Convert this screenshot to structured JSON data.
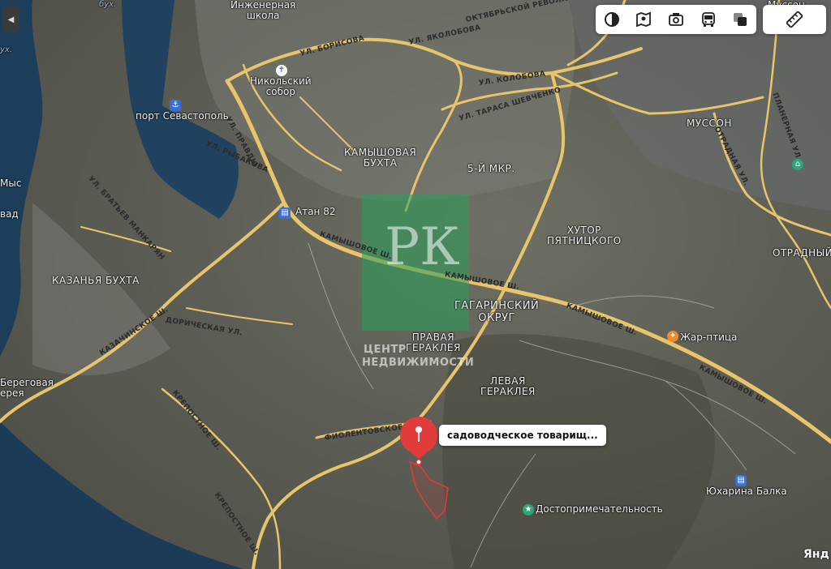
{
  "map": {
    "place_labels": {
      "engineering_school": "Инженерная\nшкола",
      "nikolsky": "Никольский\nсобор",
      "port": "порт Севастополь",
      "atan": "Атан 82",
      "kamyshovaya_bukhta": "КАМЫШОВАЯ\nБУХТА",
      "fifth_mkr": "5-Й МКР.",
      "khutor": "ХУТОР\nПЯТНИЦКОГО",
      "gagarinsky": "ГАГАРИНСКИЙ\nОКРУГ",
      "pravaya": "ПРАВАЯ\nГЕРАКЛЕЯ",
      "levaya": "ЛЕВАЯ\nГЕРАКЛЕЯ",
      "kazachya": "КАЗАНЬЯ БУХТА",
      "zhar_ptitsa": "Жар-птица",
      "mussons_top": "Муссон",
      "musson": "МУССОН",
      "otradny": "ОТРАДНЫЙ",
      "yuharina": "Юхарина Балка",
      "dostoprim": "Достопримечательность",
      "beregovaya": "Береговая\nерея",
      "mys": "Мыс",
      "vad": "вад",
      "bukh_top": "бух.",
      "bukh_left": "ух."
    },
    "street_labels": {
      "borisova": "УЛ. БОРИСОВА",
      "kolobova": "УЛ. КОЛОБОВА",
      "yakolobova": "УЛ. ЯКОЛОБОВА",
      "shevchenko": "УЛ. ТАРАСА ШЕВЧЕНКО",
      "revolyutsii": "ОКТЯБРЬСКОЙ РЕВОЛЮЦИИ",
      "kamyshovoe1": "КАМЫШОВОЕ Ш.",
      "kamyshovoe2": "КАМЫШОВОЕ Ш.",
      "kamyshovoe3": "КАМЫШОВОЕ Ш.",
      "kamyshovoe4": "КАМЫШОВОЕ Ш.",
      "kazachye": "КАЗАЧИНСКОЕ Ш.",
      "doricheskaya": "ДОРИЧЕСКАЯ УЛ.",
      "fiolentovskoe": "ФИОЛЕНТОВСКОЕ Ш.",
      "krepostnoe1": "КРЕПОСТНОЕ Ш.",
      "krepostnoe2": "КРЕПОСТНОЕ Ш.",
      "bratskaya": "УЛ. БРАТЬЕВ МАНКАРЯН",
      "pravdy": "УЛ. ПРАВДЫ",
      "rybakova": "УЛ. РЫБАКОВА",
      "planernaya": "ПЛАНЕРНАЯ УЛ.",
      "otradnaya": "ОТРАДНАЯ УЛ."
    },
    "callout_text": "садоводческое товарищ...",
    "watermark": {
      "initials": "РК",
      "line1": "ЦЕНТР",
      "line2": "НЕДВИЖИМОСТИ"
    },
    "attribution": "Янд"
  },
  "toolbar": {
    "icons": [
      "layers-icon",
      "map-icon",
      "panorama-camera-icon",
      "bus-icon",
      "stack-icon"
    ],
    "ruler_icon": "ruler-icon",
    "back_glyph": "◀"
  },
  "colors": {
    "road": "#e8c46a",
    "route": "#e23b3b",
    "watermark": "#28a05a",
    "water": "#1d3e5a",
    "poi_blue": "#3a6fd8",
    "poi_green": "#2aa878",
    "poi_orange": "#f08a2a"
  }
}
